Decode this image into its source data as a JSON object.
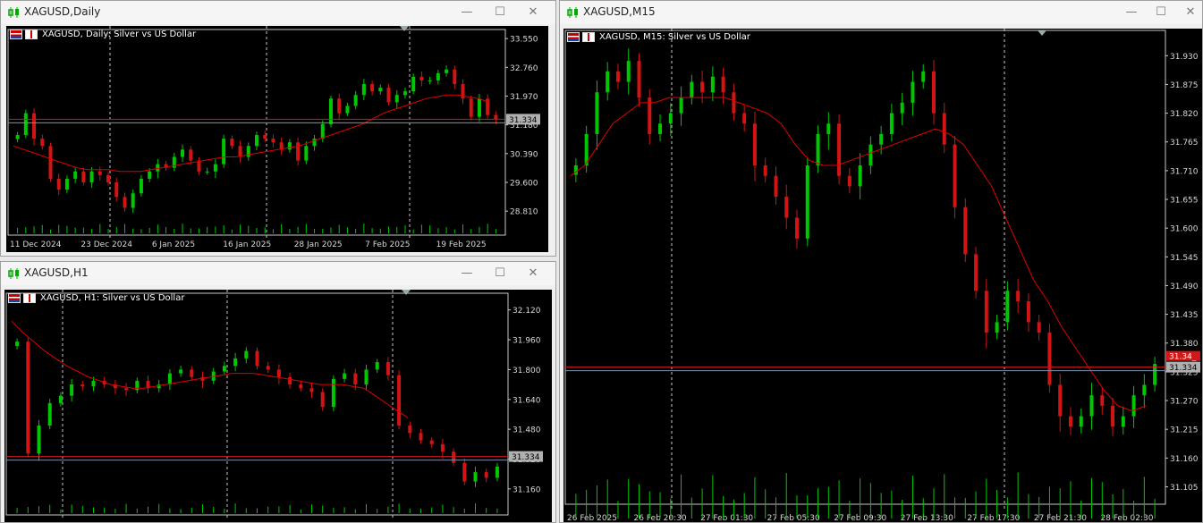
{
  "windows": {
    "daily": {
      "title": "XAGUSD,Daily",
      "chart_label": "XAGUSD, Daily:  Silver vs US Dollar"
    },
    "h1": {
      "title": "XAGUSD,H1",
      "chart_label": "XAGUSD, H1:  Silver vs US Dollar"
    },
    "m15": {
      "title": "XAGUSD,M15",
      "chart_label": "XAGUSD, M15:  Silver vs US Dollar"
    }
  },
  "window_buttons": {
    "minimize": "—",
    "maximize": "☐",
    "close": "✕"
  },
  "colors": {
    "bull": "#00c800",
    "bear": "#d21414",
    "ma": "#e00000",
    "grid": "#c8c8c8",
    "bid_line": "#d01818",
    "ask_line": "#8090b0"
  },
  "chart_data": [
    {
      "type": "candlestick",
      "name": "daily",
      "ylim": [
        28.2,
        33.75
      ],
      "yticks": [
        "33.550",
        "32.760",
        "31.970",
        "31.180",
        "30.390",
        "29.600",
        "28.810"
      ],
      "xlabels": [
        "11 Dec 2024",
        "23 Dec 2024",
        "6 Jan 2025",
        "16 Jan 2025",
        "28 Jan 2025",
        "7 Feb 2025",
        "19 Feb 2025"
      ],
      "price_label": "31.334",
      "price": 31.334,
      "points": [
        30.9,
        31.5,
        30.8,
        30.6,
        29.7,
        29.4,
        29.7,
        29.9,
        29.6,
        29.9,
        29.8,
        29.6,
        29.2,
        28.9,
        29.3,
        29.7,
        29.9,
        30.1,
        30.0,
        30.3,
        30.5,
        30.2,
        29.9,
        29.9,
        30.1,
        30.8,
        30.6,
        30.3,
        30.6,
        30.9,
        30.8,
        30.7,
        30.5,
        30.7,
        30.2,
        30.6,
        30.8,
        31.2,
        31.9,
        31.5,
        31.7,
        32.0,
        32.3,
        32.1,
        32.2,
        31.8,
        32.0,
        32.1,
        32.5,
        32.4,
        32.4,
        32.6,
        32.7,
        32.3,
        31.9,
        31.4,
        31.9,
        31.45,
        31.33
      ],
      "ma": [
        30.6,
        30.5,
        30.4,
        30.3,
        30.2,
        30.1,
        30.0,
        29.95,
        29.95,
        29.95,
        29.9,
        29.9,
        29.9,
        29.95,
        30.0,
        30.05,
        30.1,
        30.15,
        30.2,
        30.25,
        30.3,
        30.3,
        30.35,
        30.4,
        30.45,
        30.5,
        30.55,
        30.6,
        30.7,
        30.8,
        30.9,
        31.0,
        31.1,
        31.2,
        31.35,
        31.5,
        31.6,
        31.7,
        31.8,
        31.9,
        31.95,
        32.0,
        32.0,
        31.95,
        31.9,
        31.8
      ]
    },
    {
      "type": "candlestick",
      "name": "h1",
      "ylim": [
        31.03,
        32.2
      ],
      "yticks": [
        "32.120",
        "31.960",
        "31.800",
        "31.640",
        "31.480",
        "31.320",
        "31.160"
      ],
      "price_label": "31.334",
      "price": 31.334,
      "points": [
        31.95,
        31.35,
        31.5,
        31.62,
        31.66,
        31.72,
        31.71,
        31.74,
        31.72,
        31.7,
        31.69,
        31.74,
        31.7,
        31.72,
        31.78,
        31.8,
        31.76,
        31.74,
        31.79,
        31.82,
        31.86,
        31.9,
        31.82,
        31.8,
        31.76,
        31.72,
        31.7,
        31.68,
        31.6,
        31.75,
        31.78,
        31.72,
        31.8,
        31.84,
        31.77,
        31.5,
        31.46,
        31.42,
        31.4,
        31.36,
        31.3,
        31.2,
        31.25,
        31.22,
        31.28
      ],
      "ma": [
        32.06,
        32.0,
        31.95,
        31.9,
        31.86,
        31.82,
        31.79,
        31.76,
        31.74,
        31.72,
        31.71,
        31.7,
        31.7,
        31.71,
        31.72,
        31.73,
        31.74,
        31.75,
        31.76,
        31.77,
        31.78,
        31.78,
        31.78,
        31.77,
        31.76,
        31.75,
        31.74,
        31.73,
        31.72,
        31.72,
        31.72,
        31.71,
        31.7,
        31.66,
        31.62,
        31.58,
        31.54
      ]
    },
    {
      "type": "candlestick",
      "name": "m15",
      "ylim": [
        31.075,
        31.975
      ],
      "yticks": [
        "31.930",
        "31.875",
        "31.820",
        "31.765",
        "31.710",
        "31.655",
        "31.600",
        "31.545",
        "31.490",
        "31.435",
        "31.380",
        "31.325",
        "31.270",
        "31.215",
        "31.160",
        "31.105"
      ],
      "xlabels": [
        "26 Feb 2025",
        "26 Feb 20:30",
        "27 Feb 01:30",
        "27 Feb 05:30",
        "27 Feb 09:30",
        "27 Feb 13:30",
        "27 Feb 17:30",
        "27 Feb 21:30",
        "28 Feb 02:30"
      ],
      "price_label": "31.334",
      "bid_label": "31.34_",
      "price": 31.334,
      "points": [
        31.72,
        31.78,
        31.86,
        31.9,
        31.88,
        31.92,
        31.85,
        31.78,
        31.8,
        31.82,
        31.85,
        31.88,
        31.86,
        31.89,
        31.86,
        31.82,
        31.8,
        31.72,
        31.7,
        31.66,
        31.62,
        31.58,
        31.72,
        31.78,
        31.8,
        31.7,
        31.68,
        31.72,
        31.76,
        31.78,
        31.82,
        31.84,
        31.88,
        31.9,
        31.82,
        31.76,
        31.64,
        31.55,
        31.48,
        31.4,
        31.42,
        31.48,
        31.46,
        31.42,
        31.4,
        31.3,
        31.24,
        31.22,
        31.24,
        31.28,
        31.26,
        31.22,
        31.24,
        31.28,
        31.3,
        31.34
      ],
      "ma": [
        31.7,
        31.72,
        31.76,
        31.8,
        31.82,
        31.84,
        31.84,
        31.85,
        31.85,
        31.85,
        31.85,
        31.85,
        31.84,
        31.83,
        31.82,
        31.8,
        31.76,
        31.73,
        31.72,
        31.72,
        31.73,
        31.74,
        31.75,
        31.76,
        31.77,
        31.78,
        31.79,
        31.78,
        31.76,
        31.72,
        31.68,
        31.62,
        31.56,
        31.5,
        31.46,
        31.41,
        31.37,
        31.33,
        31.29,
        31.26,
        31.25,
        31.26
      ]
    }
  ]
}
